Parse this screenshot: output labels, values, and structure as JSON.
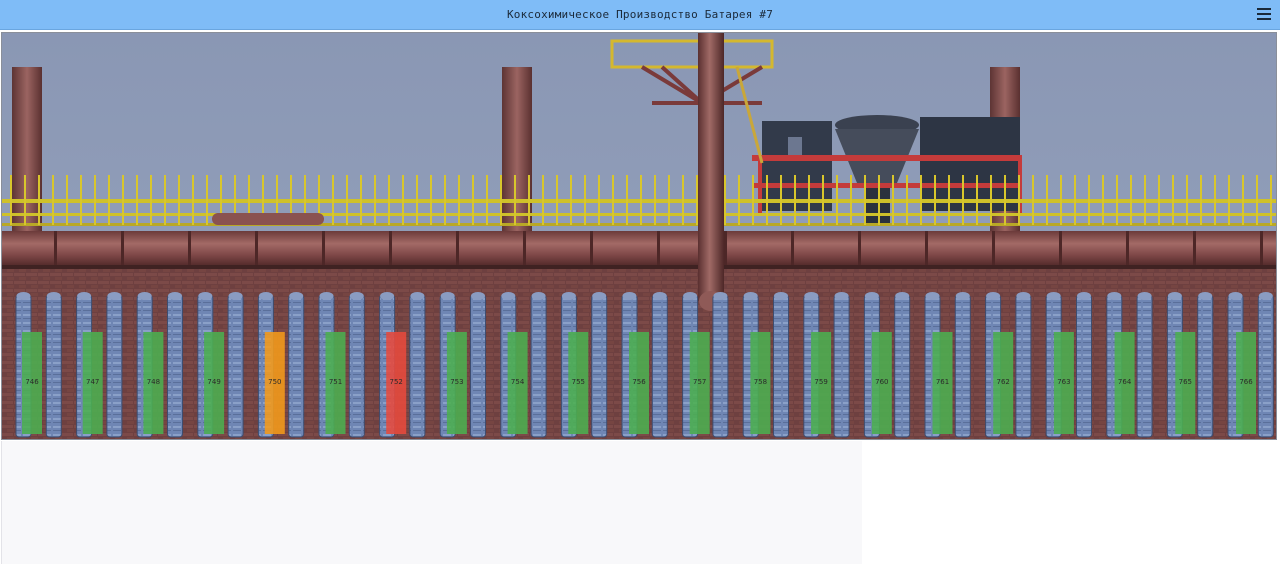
{
  "header": {
    "title": "Коксохимическое Производство Батарея #7",
    "menu_icon": "hamburger-menu-icon"
  },
  "colors": {
    "topbar": "#7fbcf7",
    "status_ok": "#4caf50",
    "status_warning": "#f59b1a",
    "status_alarm": "#e84a3c"
  },
  "ovens": [
    {
      "id": "746",
      "status": "ok"
    },
    {
      "id": "747",
      "status": "ok"
    },
    {
      "id": "748",
      "status": "ok"
    },
    {
      "id": "749",
      "status": "ok"
    },
    {
      "id": "750",
      "status": "warning"
    },
    {
      "id": "751",
      "status": "ok"
    },
    {
      "id": "752",
      "status": "alarm"
    },
    {
      "id": "753",
      "status": "ok"
    },
    {
      "id": "754",
      "status": "ok"
    },
    {
      "id": "755",
      "status": "ok"
    },
    {
      "id": "756",
      "status": "ok"
    },
    {
      "id": "757",
      "status": "ok"
    },
    {
      "id": "758",
      "status": "ok"
    },
    {
      "id": "759",
      "status": "ok"
    },
    {
      "id": "760",
      "status": "ok"
    },
    {
      "id": "761",
      "status": "ok"
    },
    {
      "id": "762",
      "status": "ok"
    },
    {
      "id": "763",
      "status": "ok"
    },
    {
      "id": "764",
      "status": "ok"
    },
    {
      "id": "765",
      "status": "ok"
    },
    {
      "id": "766",
      "status": "ok"
    }
  ]
}
